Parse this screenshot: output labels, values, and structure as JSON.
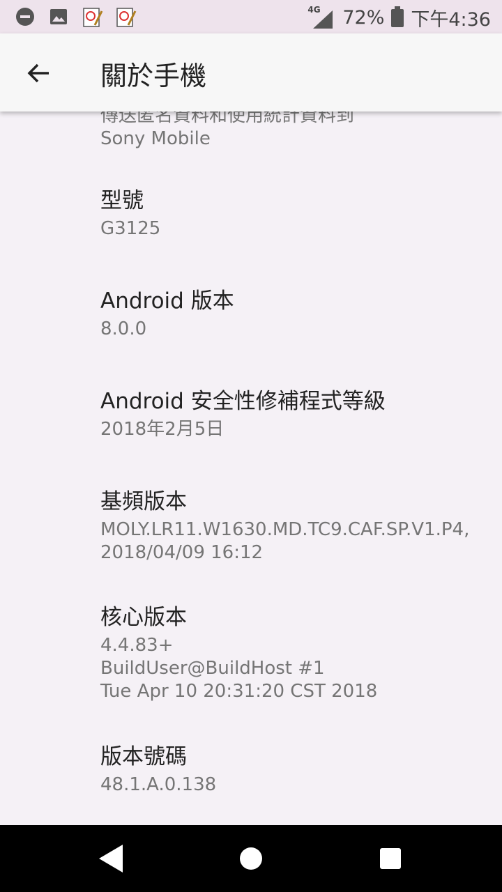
{
  "status_bar": {
    "network_label": "4G",
    "battery": "72%",
    "time": "下午4:36"
  },
  "app_bar": {
    "title": "關於手機"
  },
  "items": [
    {
      "title": "",
      "subtitle": "傳送匿名資料和使用統計資料到\nSony Mobile"
    },
    {
      "title": "型號",
      "subtitle": "G3125"
    },
    {
      "title": "Android 版本",
      "subtitle": "8.0.0"
    },
    {
      "title": "Android 安全性修補程式等級",
      "subtitle": "2018年2月5日"
    },
    {
      "title": "基頻版本",
      "subtitle": "MOLY.LR11.W1630.MD.TC9.CAF.SP.V1.P4,\n2018/04/09 16:12"
    },
    {
      "title": "核心版本",
      "subtitle": "4.4.83+\nBuildUser@BuildHost #1\nTue Apr 10 20:31:20 CST 2018"
    },
    {
      "title": "版本號碼",
      "subtitle": "48.1.A.0.138"
    }
  ],
  "colors": {
    "status_bar_bg": "#eee3ec",
    "background": "#f5f1f6",
    "app_bar_bg": "#f7f7f7",
    "nav_bar_bg": "#000000"
  }
}
